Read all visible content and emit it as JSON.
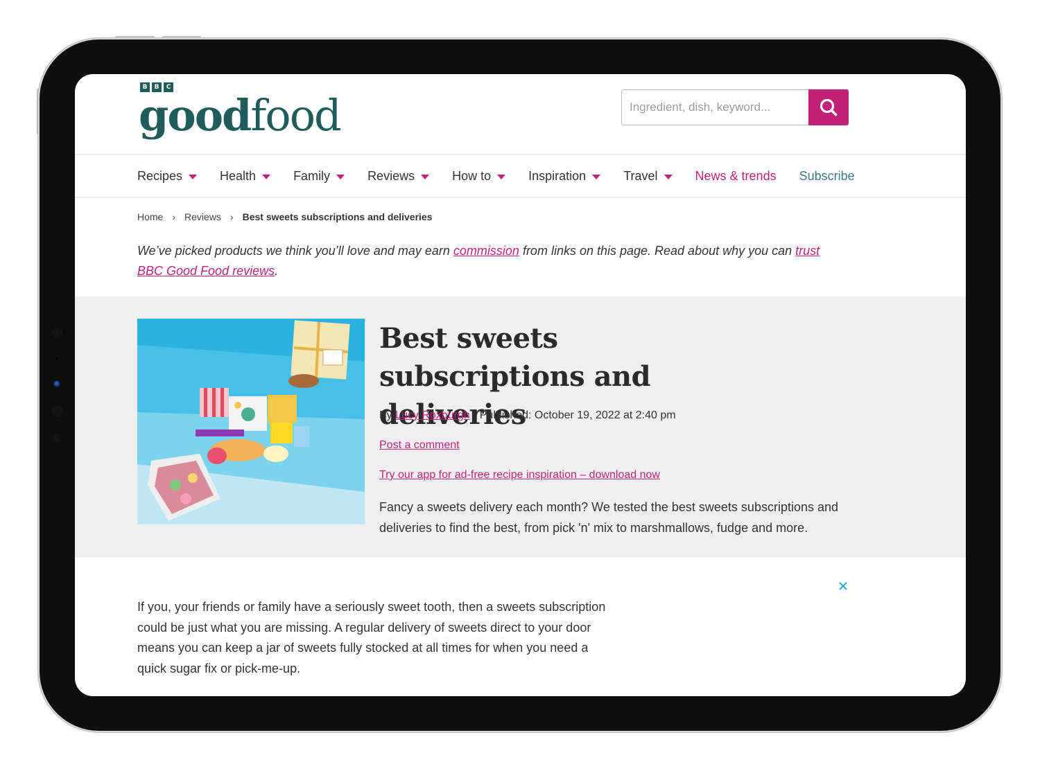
{
  "site": {
    "logo_small": [
      "B",
      "B",
      "C"
    ],
    "logo_bold": "good",
    "logo_regular": "food",
    "brand_color": "#1f5c5a",
    "accent_color": "#c0227a"
  },
  "search": {
    "placeholder": "Ingredient, dish, keyword...",
    "value": "",
    "button_icon": "search-icon"
  },
  "nav": {
    "items": [
      {
        "label": "Recipes",
        "has_dropdown": true
      },
      {
        "label": "Health",
        "has_dropdown": true
      },
      {
        "label": "Family",
        "has_dropdown": true
      },
      {
        "label": "Reviews",
        "has_dropdown": true
      },
      {
        "label": "How to",
        "has_dropdown": true
      },
      {
        "label": "Inspiration",
        "has_dropdown": true
      },
      {
        "label": "Travel",
        "has_dropdown": true
      },
      {
        "label": "News & trends",
        "has_dropdown": false
      },
      {
        "label": "Subscribe",
        "has_dropdown": false
      }
    ]
  },
  "breadcrumb": {
    "items": [
      "Home",
      "Reviews"
    ],
    "current": "Best sweets subscriptions and deliveries",
    "separator_icon": "chevron-right-icon"
  },
  "disclaimer": {
    "text_1": "We’ve picked products we think you’ll love and may earn ",
    "link_1": "commission",
    "text_2": " from links on this page. Read about why you can ",
    "link_2": "trust BBC Good Food reviews",
    "text_3": "."
  },
  "article": {
    "title": "Best sweets subscriptions and deliveries",
    "by_label": "By ",
    "author": "Lucy Roxburgh",
    "published": "Published: October 19, 2022 at 2:40 pm",
    "comment_link": "Post a comment",
    "app_link": "Try our app for ad-free recipe inspiration – download now",
    "description": "Fancy a sweets delivery each month? We tested the best sweets subscriptions and deliveries to find the best, from pick 'n' mix to marshmallows, fudge and more.",
    "hero_image_alt": "Sweets subscription boxes on a blue background",
    "intro": "If you, your friends or family have a seriously sweet tooth, then a sweets subscription could be just what you are missing. A regular delivery of sweets direct to your door means you can keep a jar of sweets fully stocked at all times for when you need a quick sugar fix or pick-me-up."
  },
  "ad": {
    "close_icon": "close-icon"
  }
}
